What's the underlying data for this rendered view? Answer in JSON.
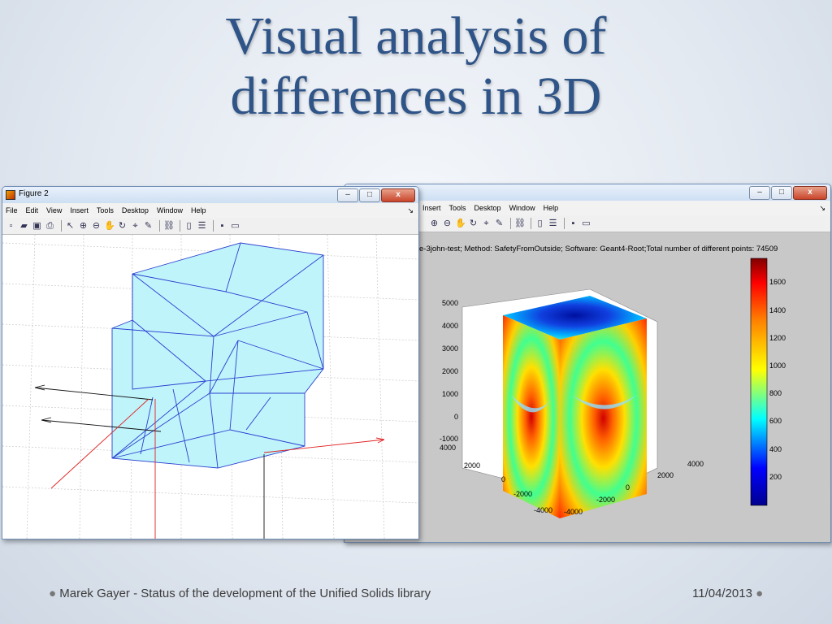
{
  "slide": {
    "title_line1": "Visual analysis of",
    "title_line2": "differences in 3D",
    "footer_left": "Marek Gayer - Status of the development of the Unified Solids library",
    "footer_date": "11/04/2013"
  },
  "left_window": {
    "title": "Figure 2",
    "menus": [
      "File",
      "Edit",
      "View",
      "Insert",
      "Tools",
      "Desktop",
      "Window",
      "Help"
    ],
    "menu_arrow": "↘"
  },
  "right_window": {
    "menus": [
      "Insert",
      "Tools",
      "Desktop",
      "Window",
      "Help"
    ],
    "menu_arrow": "↘",
    "plot_title": "e-3john-test; Method: SafetyFromOutside; Software: Geant4-Root;Total number of different points: 74509",
    "z_ticks": [
      "5000",
      "4000",
      "3000",
      "2000",
      "1000",
      "0",
      "-1000"
    ],
    "y_ticks": [
      "4000",
      "2000",
      "0",
      "-2000",
      "-4000"
    ],
    "x_ticks": [
      "-4000",
      "-2000",
      "0",
      "2000",
      "4000"
    ],
    "colorbar_ticks": [
      "1600",
      "1400",
      "1200",
      "1000",
      "800",
      "600",
      "400",
      "200"
    ]
  },
  "window_controls": {
    "minimize": "–",
    "maximize": "□",
    "close": "x"
  },
  "icons": [
    "new-file-icon",
    "open-icon",
    "save-icon",
    "print-icon",
    "pointer-icon",
    "zoom-in-icon",
    "zoom-out-icon",
    "pan-icon",
    "rotate-icon",
    "datacursor-icon",
    "brush-icon",
    "link-icon",
    "colorbar-icon",
    "legend-icon",
    "grid-icon",
    "plotbrowser-icon"
  ],
  "colors": {
    "title": "#2f5487",
    "mesh_line": "#2b3fd0",
    "mesh_fill": "#bff4fb",
    "axis_red": "#e02020"
  }
}
